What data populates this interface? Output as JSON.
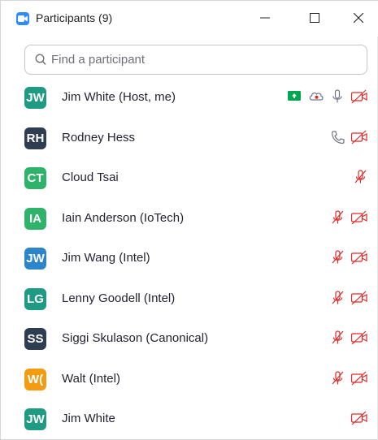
{
  "window": {
    "title": "Participants (9)"
  },
  "search": {
    "placeholder": "Find a participant",
    "value": ""
  },
  "colors": {
    "accent": "#2d8cff",
    "muted_red": "#e02828",
    "icon_gray": "#747487",
    "share_green": "#00a651"
  },
  "participants": [
    {
      "initials": "JW",
      "name": "Jim White (Host, me)",
      "color": "#1f9a83",
      "icons": [
        "share-screen-icon",
        "record-cloud-icon",
        "mic-on-icon",
        "video-off-icon"
      ]
    },
    {
      "initials": "RH",
      "name": "Rodney Hess",
      "color": "#2f3d52",
      "icons": [
        "phone-icon",
        "video-off-icon"
      ]
    },
    {
      "initials": "CT",
      "name": "Cloud Tsai",
      "color": "#2fb36b",
      "icons": [
        "mic-muted-icon"
      ]
    },
    {
      "initials": "IA",
      "name": "Iain Anderson (IoTech)",
      "color": "#2fb36b",
      "icons": [
        "mic-muted-icon",
        "video-off-icon"
      ]
    },
    {
      "initials": "JW",
      "name": "Jim Wang (Intel)",
      "color": "#2c85c8",
      "icons": [
        "mic-muted-icon",
        "video-off-icon"
      ]
    },
    {
      "initials": "LG",
      "name": "Lenny Goodell (Intel)",
      "color": "#1f9a83",
      "icons": [
        "mic-muted-icon",
        "video-off-icon"
      ]
    },
    {
      "initials": "SS",
      "name": "Siggi Skulason (Canonical)",
      "color": "#2f3d52",
      "icons": [
        "mic-muted-icon",
        "video-off-icon"
      ]
    },
    {
      "initials": "W(",
      "name": "Walt (Intel)",
      "color": "#f39c12",
      "icons": [
        "mic-muted-icon",
        "video-off-icon"
      ]
    },
    {
      "initials": "JW",
      "name": "Jim White",
      "color": "#1f9a83",
      "icons": [
        "video-off-icon"
      ]
    }
  ]
}
